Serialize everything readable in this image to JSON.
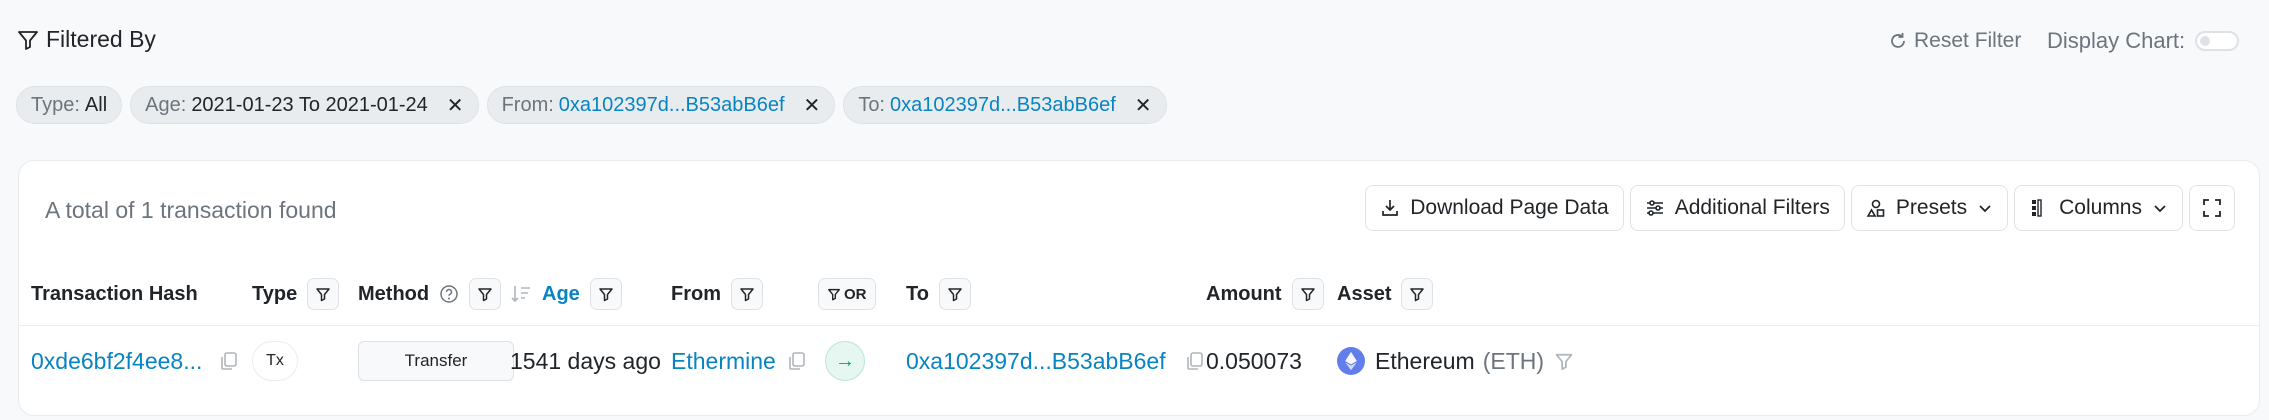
{
  "filter_bar": {
    "title": "Filtered By",
    "reset_label": "Reset Filter",
    "display_chart_label": "Display Chart:",
    "chips": [
      {
        "key": "Type:",
        "value": "All"
      },
      {
        "key": "Age:",
        "value": "2021-01-23 To 2021-01-24"
      },
      {
        "key": "From:",
        "value": "0xa102397d...B53abB6ef"
      },
      {
        "key": "To:",
        "value": "0xa102397d...B53abB6ef"
      }
    ],
    "remove_glyph": "✕"
  },
  "card": {
    "total_text": "A total of 1 transaction found",
    "toolbar": {
      "download": "Download Page Data",
      "additional_filters": "Additional Filters",
      "presets": "Presets",
      "columns": "Columns"
    },
    "columns": {
      "hash": "Transaction Hash",
      "type": "Type",
      "method": "Method",
      "age": "Age",
      "from": "From",
      "or": "OR",
      "to": "To",
      "amount": "Amount",
      "asset": "Asset"
    },
    "rows": [
      {
        "hash": "0xde6bf2f4ee8...",
        "type": "Tx",
        "method": "Transfer",
        "age": "1541 days ago",
        "from": "Ethermine",
        "direction": "→",
        "to": "0xa102397d...B53abB6ef",
        "amount": "0.050073",
        "asset_name": "Ethereum",
        "asset_symbol": "(ETH)"
      }
    ]
  },
  "colors": {
    "link": "#0784c3",
    "muted": "#6c757d",
    "in_green": "#00a186",
    "eth": "#627eea"
  },
  "icons": [
    "filter-icon",
    "reset-icon",
    "toggle-switch",
    "close-icon",
    "download-icon",
    "sliders-icon",
    "presets-icon",
    "columns-icon",
    "chevron-down-icon",
    "expand-icon",
    "help-icon",
    "sort-icon",
    "copy-icon",
    "arrow-right-icon",
    "ethereum-icon"
  ]
}
